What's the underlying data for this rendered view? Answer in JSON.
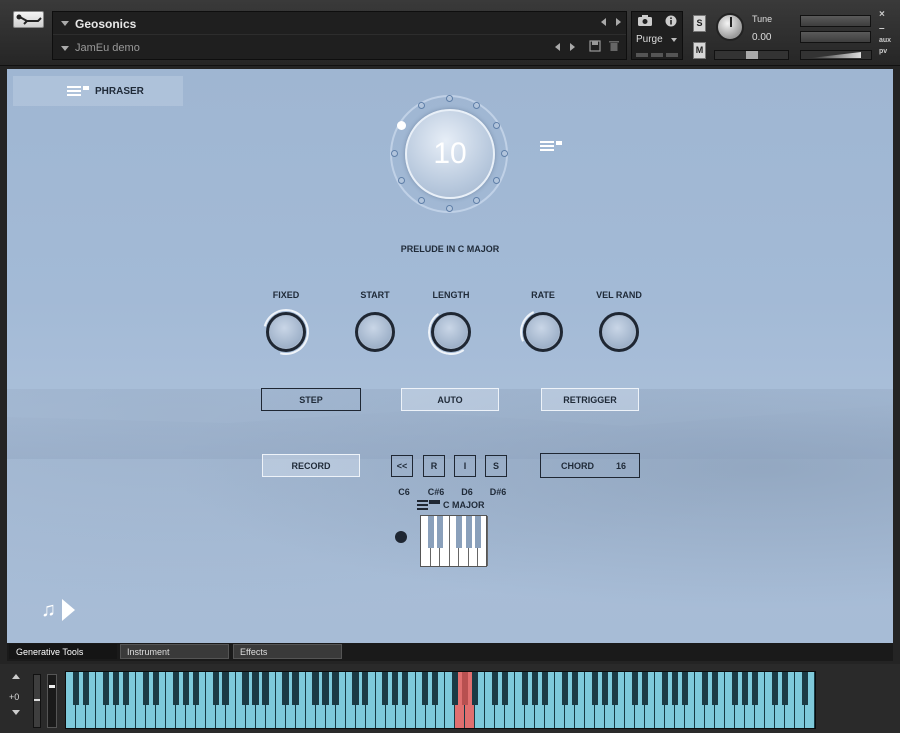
{
  "header": {
    "instrument_name": "Geosonics",
    "multi_name": "JamEu demo",
    "purge_label": "Purge",
    "solo_label": "S",
    "mute_label": "M",
    "tune_label": "Tune",
    "tune_value": "0.00",
    "close_label": "×",
    "minimize_label": "–",
    "aux_label": "aux",
    "pv_label": "pv"
  },
  "phraser": {
    "tab_label": "PHRASER",
    "preset_number": "10",
    "preset_name": "PRELUDE IN C MAJOR",
    "knobs": [
      {
        "label": "FIXED"
      },
      {
        "label": "START"
      },
      {
        "label": "LENGTH"
      },
      {
        "label": "RATE"
      },
      {
        "label": "VEL RAND"
      }
    ],
    "mode_buttons": {
      "step": "STEP",
      "auto": "AUTO",
      "retrigger": "RETRIGGER"
    },
    "record_label": "RECORD",
    "transport": {
      "rewind": "<<",
      "r": "R",
      "i": "I",
      "s": "S"
    },
    "note_labels": [
      "C6",
      "C#6",
      "D6",
      "D#6"
    ],
    "chord_label": "CHORD",
    "chord_value": "16",
    "scale_label": "C MAJOR",
    "note_glyph": "♫"
  },
  "tabs": [
    "Generative Tools",
    "Instrument",
    "Effects"
  ],
  "keyboard": {
    "octave_offset": "+0"
  },
  "colors": {
    "panel_bg": "#a3bad6",
    "key_white": "#7ec9da",
    "key_black": "#1b3a44",
    "key_highlight": "#e06f6f"
  }
}
